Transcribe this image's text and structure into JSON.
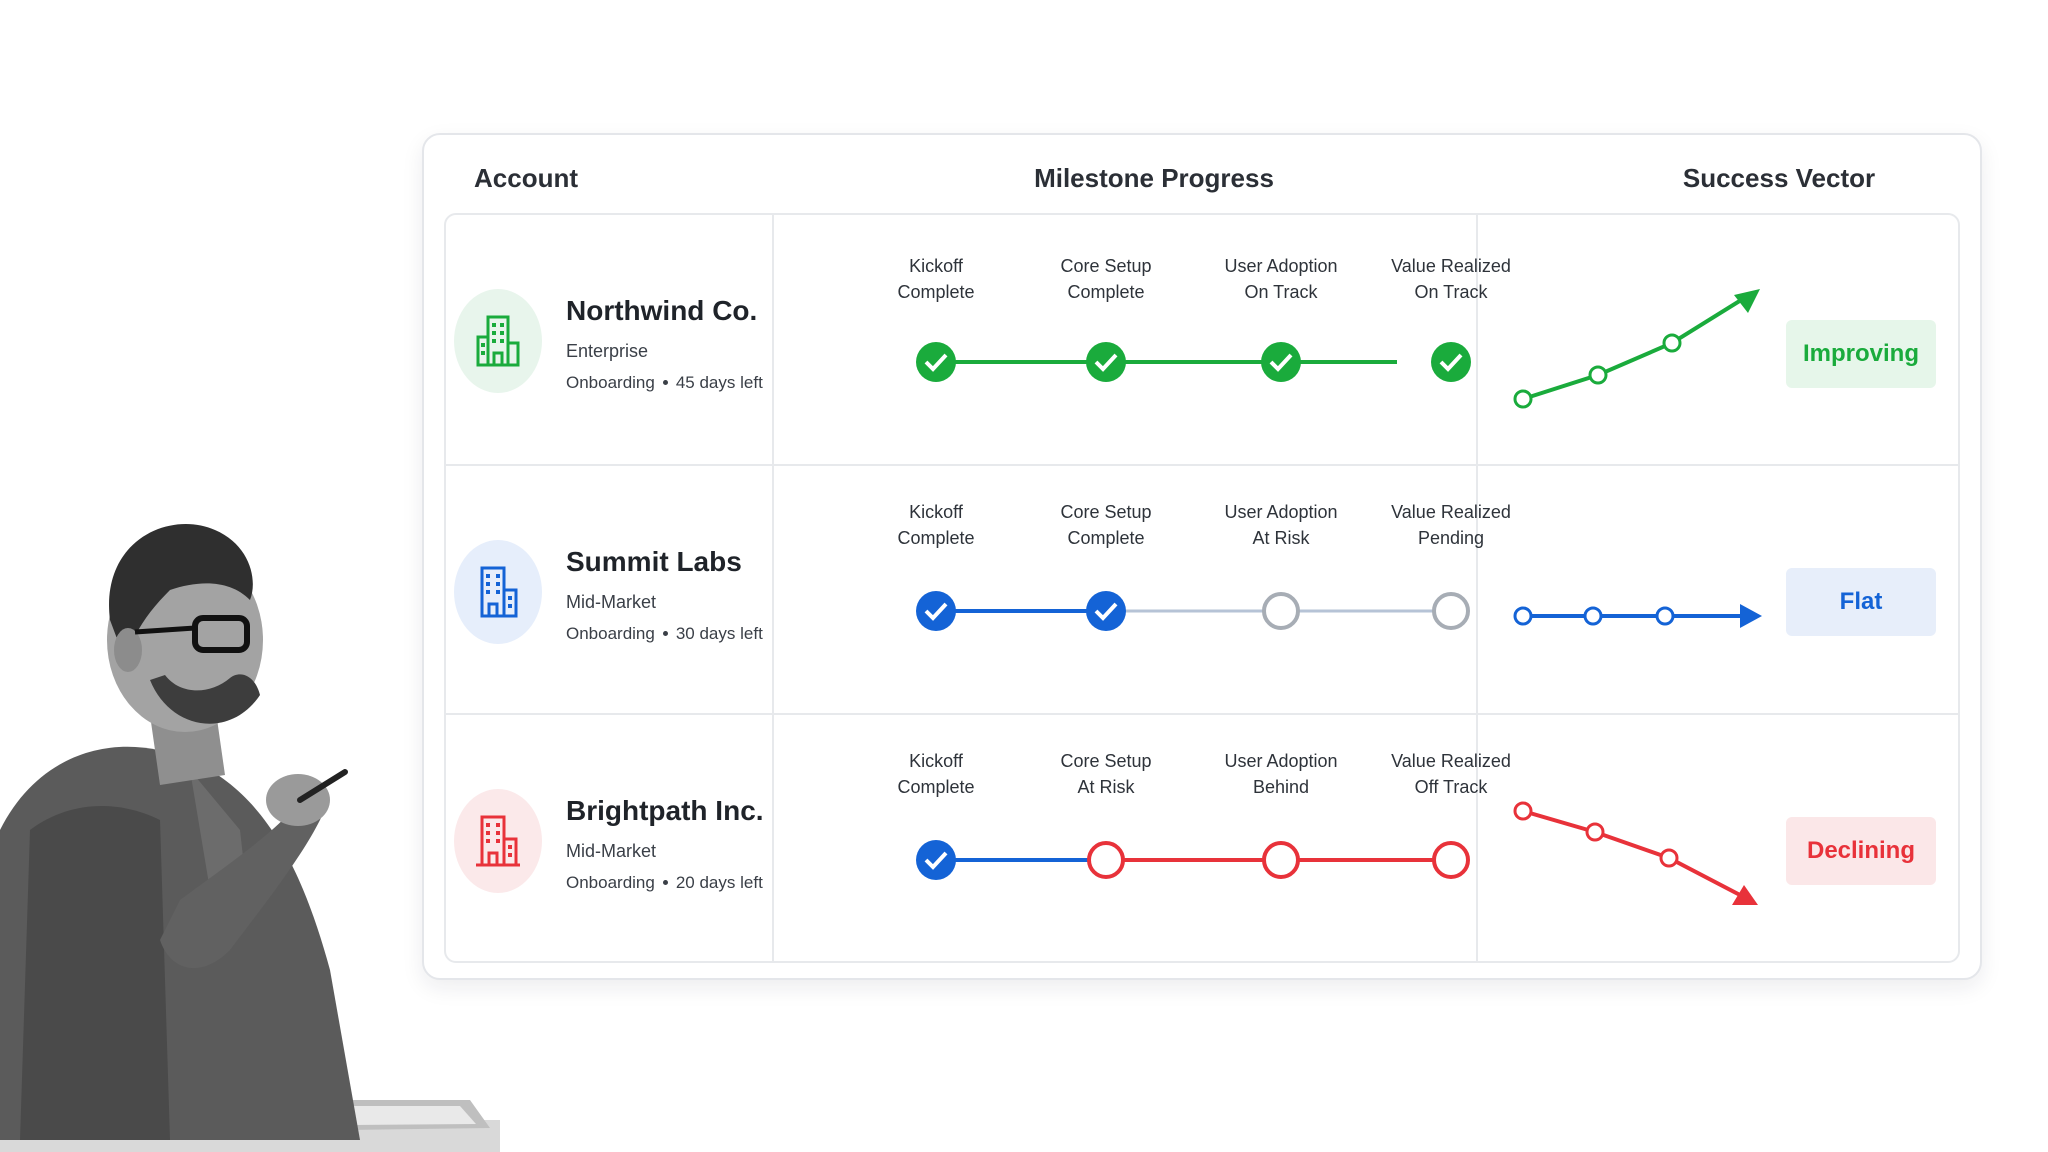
{
  "header": {
    "account_label": "Account",
    "milestone_label": "Milestone Progress",
    "vector_label": "Success Vector"
  },
  "colors": {
    "green": "#1aab3c",
    "blue": "#1463d6",
    "red": "#e8323a",
    "gray": "#a7adb5"
  },
  "accounts": [
    {
      "name": "Northwind Co.",
      "tier": "Enterprise",
      "stage": "Onboarding",
      "days_left": "45 days left",
      "icon": "building-icon",
      "milestones": [
        {
          "title": "Kickoff",
          "status": "Complete",
          "state": "done"
        },
        {
          "title": "Core Setup",
          "status": "Complete",
          "state": "done"
        },
        {
          "title": "User Adoption",
          "status": "On Track",
          "state": "done"
        },
        {
          "title": "Value Realized",
          "status": "On Track",
          "state": "done"
        }
      ],
      "trend": "Improving"
    },
    {
      "name": "Summit Labs",
      "tier": "Mid-Market",
      "stage": "Onboarding",
      "days_left": "30 days left",
      "icon": "building-icon",
      "milestones": [
        {
          "title": "Kickoff",
          "status": "Complete",
          "state": "done"
        },
        {
          "title": "Core Setup",
          "status": "Complete",
          "state": "done"
        },
        {
          "title": "User Adoption",
          "status": "At Risk",
          "state": "pending"
        },
        {
          "title": "Value Realized",
          "status": "Pending",
          "state": "pending"
        }
      ],
      "trend": "Flat"
    },
    {
      "name": "Brightpath Inc.",
      "tier": "Mid-Market",
      "stage": "Onboarding",
      "days_left": "20 days left",
      "icon": "building-icon",
      "milestones": [
        {
          "title": "Kickoff",
          "status": "Complete",
          "state": "done"
        },
        {
          "title": "Core Setup",
          "status": "At Risk",
          "state": "risk"
        },
        {
          "title": "User Adoption",
          "status": "Behind",
          "state": "risk"
        },
        {
          "title": "Value Realized",
          "status": "Off Track",
          "state": "risk"
        }
      ],
      "trend": "Declining"
    }
  ]
}
